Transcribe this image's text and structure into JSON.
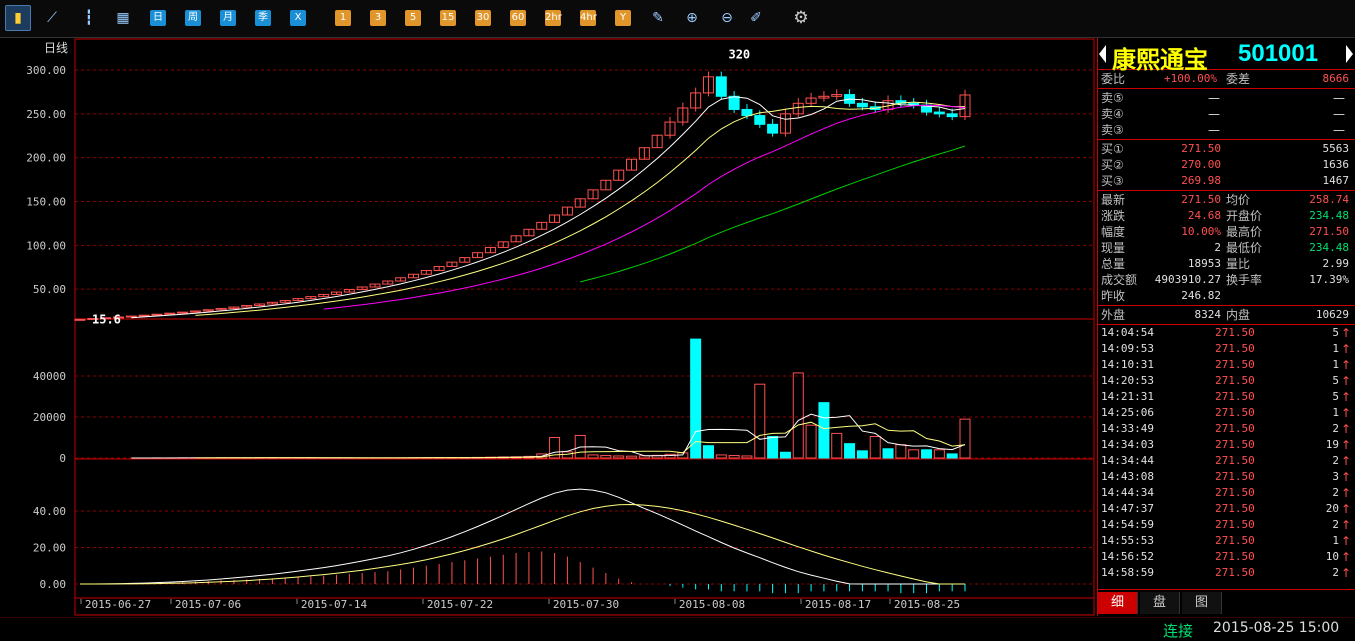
{
  "toolbar": {
    "items": [
      {
        "name": "bar-chart-icon",
        "label": "",
        "kind": "icon"
      },
      {
        "name": "line-chart-icon",
        "label": "",
        "kind": "icon"
      },
      {
        "name": "candle-icon",
        "label": "",
        "kind": "icon"
      },
      {
        "name": "calendar-icon",
        "label": "",
        "kind": "icon"
      },
      {
        "name": "period-day",
        "label": "日",
        "kind": "blue"
      },
      {
        "name": "period-week",
        "label": "周",
        "kind": "blue"
      },
      {
        "name": "period-month",
        "label": "月",
        "kind": "blue"
      },
      {
        "name": "period-season",
        "label": "季",
        "kind": "blue"
      },
      {
        "name": "period-x",
        "label": "X",
        "kind": "blue"
      },
      {
        "name": "period-1min",
        "label": "1",
        "kind": "orange"
      },
      {
        "name": "period-3min",
        "label": "3",
        "kind": "orange"
      },
      {
        "name": "period-5min",
        "label": "5",
        "kind": "orange"
      },
      {
        "name": "period-15min",
        "label": "15",
        "kind": "orange"
      },
      {
        "name": "period-30min",
        "label": "30",
        "kind": "orange"
      },
      {
        "name": "period-60min",
        "label": "60",
        "kind": "orange"
      },
      {
        "name": "period-2hr",
        "label": "2hr",
        "kind": "orange"
      },
      {
        "name": "period-4hr",
        "label": "4hr",
        "kind": "orange"
      },
      {
        "name": "period-year",
        "label": "Y",
        "kind": "orange"
      },
      {
        "name": "edit-icon",
        "label": "",
        "kind": "icon"
      },
      {
        "name": "zoom-in-icon",
        "label": "",
        "kind": "icon"
      },
      {
        "name": "zoom-out-icon",
        "label": "",
        "kind": "icon"
      },
      {
        "name": "draw-icon",
        "label": "",
        "kind": "icon"
      },
      {
        "name": "gear-icon",
        "label": "",
        "kind": "icon"
      }
    ]
  },
  "chart_data": {
    "type": "candlestick",
    "period_label": "日线",
    "price_axis": {
      "ticks": [
        "300.00",
        "250.00",
        "200.00",
        "150.00",
        "100.00",
        "50.00"
      ],
      "ylim": [
        0,
        320
      ]
    },
    "volume_axis": {
      "ticks": [
        "40000",
        "20000",
        "0"
      ]
    },
    "indicator_axis": {
      "ticks": [
        "40.00",
        "20.00",
        "0.00"
      ]
    },
    "x_labels": [
      "2015-06-27",
      "2015-07-06",
      "2015-07-14",
      "2015-07-22",
      "2015-07-30",
      "2015-08-08",
      "2015-08-17",
      "2015-08-25"
    ],
    "annotations": {
      "high": "320",
      "low": "15.6"
    },
    "colors": {
      "up": "#ff5050",
      "down": "#00ffff",
      "ma5": "#ffffff",
      "ma10": "#ffff80",
      "ma20": "#ff00ff",
      "ma60": "#00d000",
      "grid": "#8b0000"
    },
    "closes": [
      15.6,
      16.5,
      17.4,
      18.3,
      19.3,
      20.3,
      21.4,
      22.6,
      23.8,
      25.1,
      26.5,
      28.0,
      29.6,
      31.3,
      33.1,
      35.0,
      37.0,
      39.2,
      41.5,
      44.0,
      46.7,
      49.5,
      52.5,
      55.8,
      59.3,
      63.0,
      67.0,
      71.3,
      75.9,
      80.8,
      86.0,
      91.6,
      97.6,
      104.0,
      110.9,
      118.3,
      126.2,
      134.6,
      143.6,
      153.1,
      163.3,
      174.2,
      185.8,
      198.2,
      211.4,
      225.6,
      240.6,
      256.7,
      273.9,
      292.2,
      270.0,
      255.0,
      248.0,
      238.0,
      228.0,
      250.0,
      262.0,
      268.0,
      270.0,
      272.0,
      262.0,
      258.0,
      255.0,
      265.0,
      262.0,
      260.0,
      252.0,
      250.0,
      246.8,
      271.5
    ],
    "volumes": [
      0,
      0,
      0,
      0,
      0,
      0,
      50,
      60,
      70,
      80,
      90,
      100,
      120,
      100,
      90,
      80,
      70,
      60,
      80,
      70,
      60,
      50,
      60,
      70,
      80,
      90,
      100,
      120,
      150,
      200,
      250,
      300,
      400,
      500,
      600,
      800,
      2000,
      10000,
      3000,
      11000,
      1500,
      1200,
      1000,
      900,
      1100,
      1300,
      1800,
      2500,
      58000,
      6000,
      1500,
      1200,
      1000,
      36000,
      10500,
      2800,
      41500,
      16000,
      27000,
      12000,
      7000,
      3500,
      10500,
      4500,
      6500,
      4000,
      4000,
      4000,
      2000,
      18953
    ],
    "volume_up": [
      false,
      false,
      false,
      false,
      false,
      false,
      true,
      true,
      true,
      true,
      true,
      true,
      true,
      true,
      true,
      true,
      true,
      true,
      true,
      true,
      true,
      true,
      true,
      true,
      true,
      true,
      true,
      true,
      true,
      true,
      true,
      true,
      true,
      true,
      true,
      true,
      true,
      true,
      true,
      true,
      true,
      true,
      true,
      true,
      true,
      true,
      true,
      true,
      false,
      false,
      true,
      true,
      true,
      true,
      false,
      false,
      true,
      true,
      false,
      true,
      false,
      false,
      true,
      false,
      true,
      true,
      false,
      true,
      false,
      true
    ],
    "macd_bars": [
      0,
      0,
      0.2,
      0.3,
      0.5,
      0.6,
      0.8,
      1,
      1.2,
      1.4,
      1.6,
      2,
      2.2,
      2.5,
      2.8,
      3.1,
      3.4,
      3.8,
      4.1,
      4.5,
      5,
      5.5,
      6,
      6.5,
      7,
      8,
      9,
      10,
      11,
      12,
      13,
      14,
      15,
      16,
      17,
      17.5,
      17.8,
      17,
      15,
      12,
      9,
      6,
      3,
      1,
      0,
      0,
      -1,
      -2,
      -3,
      -3,
      -4,
      -4,
      -4,
      -4,
      -5,
      -5,
      -5,
      -4,
      -4,
      -4,
      -4,
      -4,
      -4,
      -4,
      -5,
      -5,
      -5,
      -4,
      -4,
      -4
    ]
  },
  "quote": {
    "name": "康熙通宝",
    "code": "501001",
    "weibi_label": "委比",
    "weibi_value": "+100.00%",
    "weicha_label": "委差",
    "weicha_value": "8666",
    "sell": [
      {
        "label": "卖⑤",
        "price": "—",
        "vol": "—"
      },
      {
        "label": "卖④",
        "price": "—",
        "vol": "—"
      },
      {
        "label": "卖③",
        "price": "—",
        "vol": "—"
      }
    ],
    "buy": [
      {
        "label": "买①",
        "price": "271.50",
        "vol": "5563"
      },
      {
        "label": "买②",
        "price": "270.00",
        "vol": "1636"
      },
      {
        "label": "买③",
        "price": "269.98",
        "vol": "1467"
      }
    ],
    "stats": [
      {
        "l1": "最新",
        "v1": "271.50",
        "l2": "均价",
        "v2": "258.74",
        "c1": "red",
        "c2": "red"
      },
      {
        "l1": "涨跌",
        "v1": "24.68",
        "l2": "开盘价",
        "v2": "234.48",
        "c1": "red",
        "c2": "green"
      },
      {
        "l1": "幅度",
        "v1": "10.00%",
        "l2": "最高价",
        "v2": "271.50",
        "c1": "red",
        "c2": "red"
      },
      {
        "l1": "现量",
        "v1": "2",
        "l2": "最低价",
        "v2": "234.48",
        "c1": "white",
        "c2": "green"
      },
      {
        "l1": "总量",
        "v1": "18953",
        "l2": "量比",
        "v2": "2.99",
        "c1": "white",
        "c2": "white"
      },
      {
        "l1": "成交额",
        "v1": "4903910.27",
        "l2": "换手率",
        "v2": "17.39%",
        "c1": "white",
        "c2": "white"
      },
      {
        "l1": "昨收",
        "v1": "246.82",
        "l2": "",
        "v2": "",
        "c1": "white",
        "c2": "white"
      }
    ],
    "outer_label": "外盘",
    "outer_value": "8324",
    "inner_label": "内盘",
    "inner_value": "10629",
    "ticks": [
      {
        "time": "14:04:54",
        "price": "271.50",
        "vol": "5"
      },
      {
        "time": "14:09:53",
        "price": "271.50",
        "vol": "1"
      },
      {
        "time": "14:10:31",
        "price": "271.50",
        "vol": "1"
      },
      {
        "time": "14:20:53",
        "price": "271.50",
        "vol": "5"
      },
      {
        "time": "14:21:31",
        "price": "271.50",
        "vol": "5"
      },
      {
        "time": "14:25:06",
        "price": "271.50",
        "vol": "1"
      },
      {
        "time": "14:33:49",
        "price": "271.50",
        "vol": "2"
      },
      {
        "time": "14:34:03",
        "price": "271.50",
        "vol": "19"
      },
      {
        "time": "14:34:44",
        "price": "271.50",
        "vol": "2"
      },
      {
        "time": "14:43:08",
        "price": "271.50",
        "vol": "3"
      },
      {
        "time": "14:44:34",
        "price": "271.50",
        "vol": "2"
      },
      {
        "time": "14:47:37",
        "price": "271.50",
        "vol": "20"
      },
      {
        "time": "14:54:59",
        "price": "271.50",
        "vol": "2"
      },
      {
        "time": "14:55:53",
        "price": "271.50",
        "vol": "1"
      },
      {
        "time": "14:56:52",
        "price": "271.50",
        "vol": "10"
      },
      {
        "time": "14:58:59",
        "price": "271.50",
        "vol": "2"
      }
    ],
    "tick_arrow": "↑",
    "tabs": [
      "细",
      "盘",
      "图"
    ]
  },
  "status": {
    "connection": "连接",
    "datetime": "2015-08-25 15:00"
  }
}
